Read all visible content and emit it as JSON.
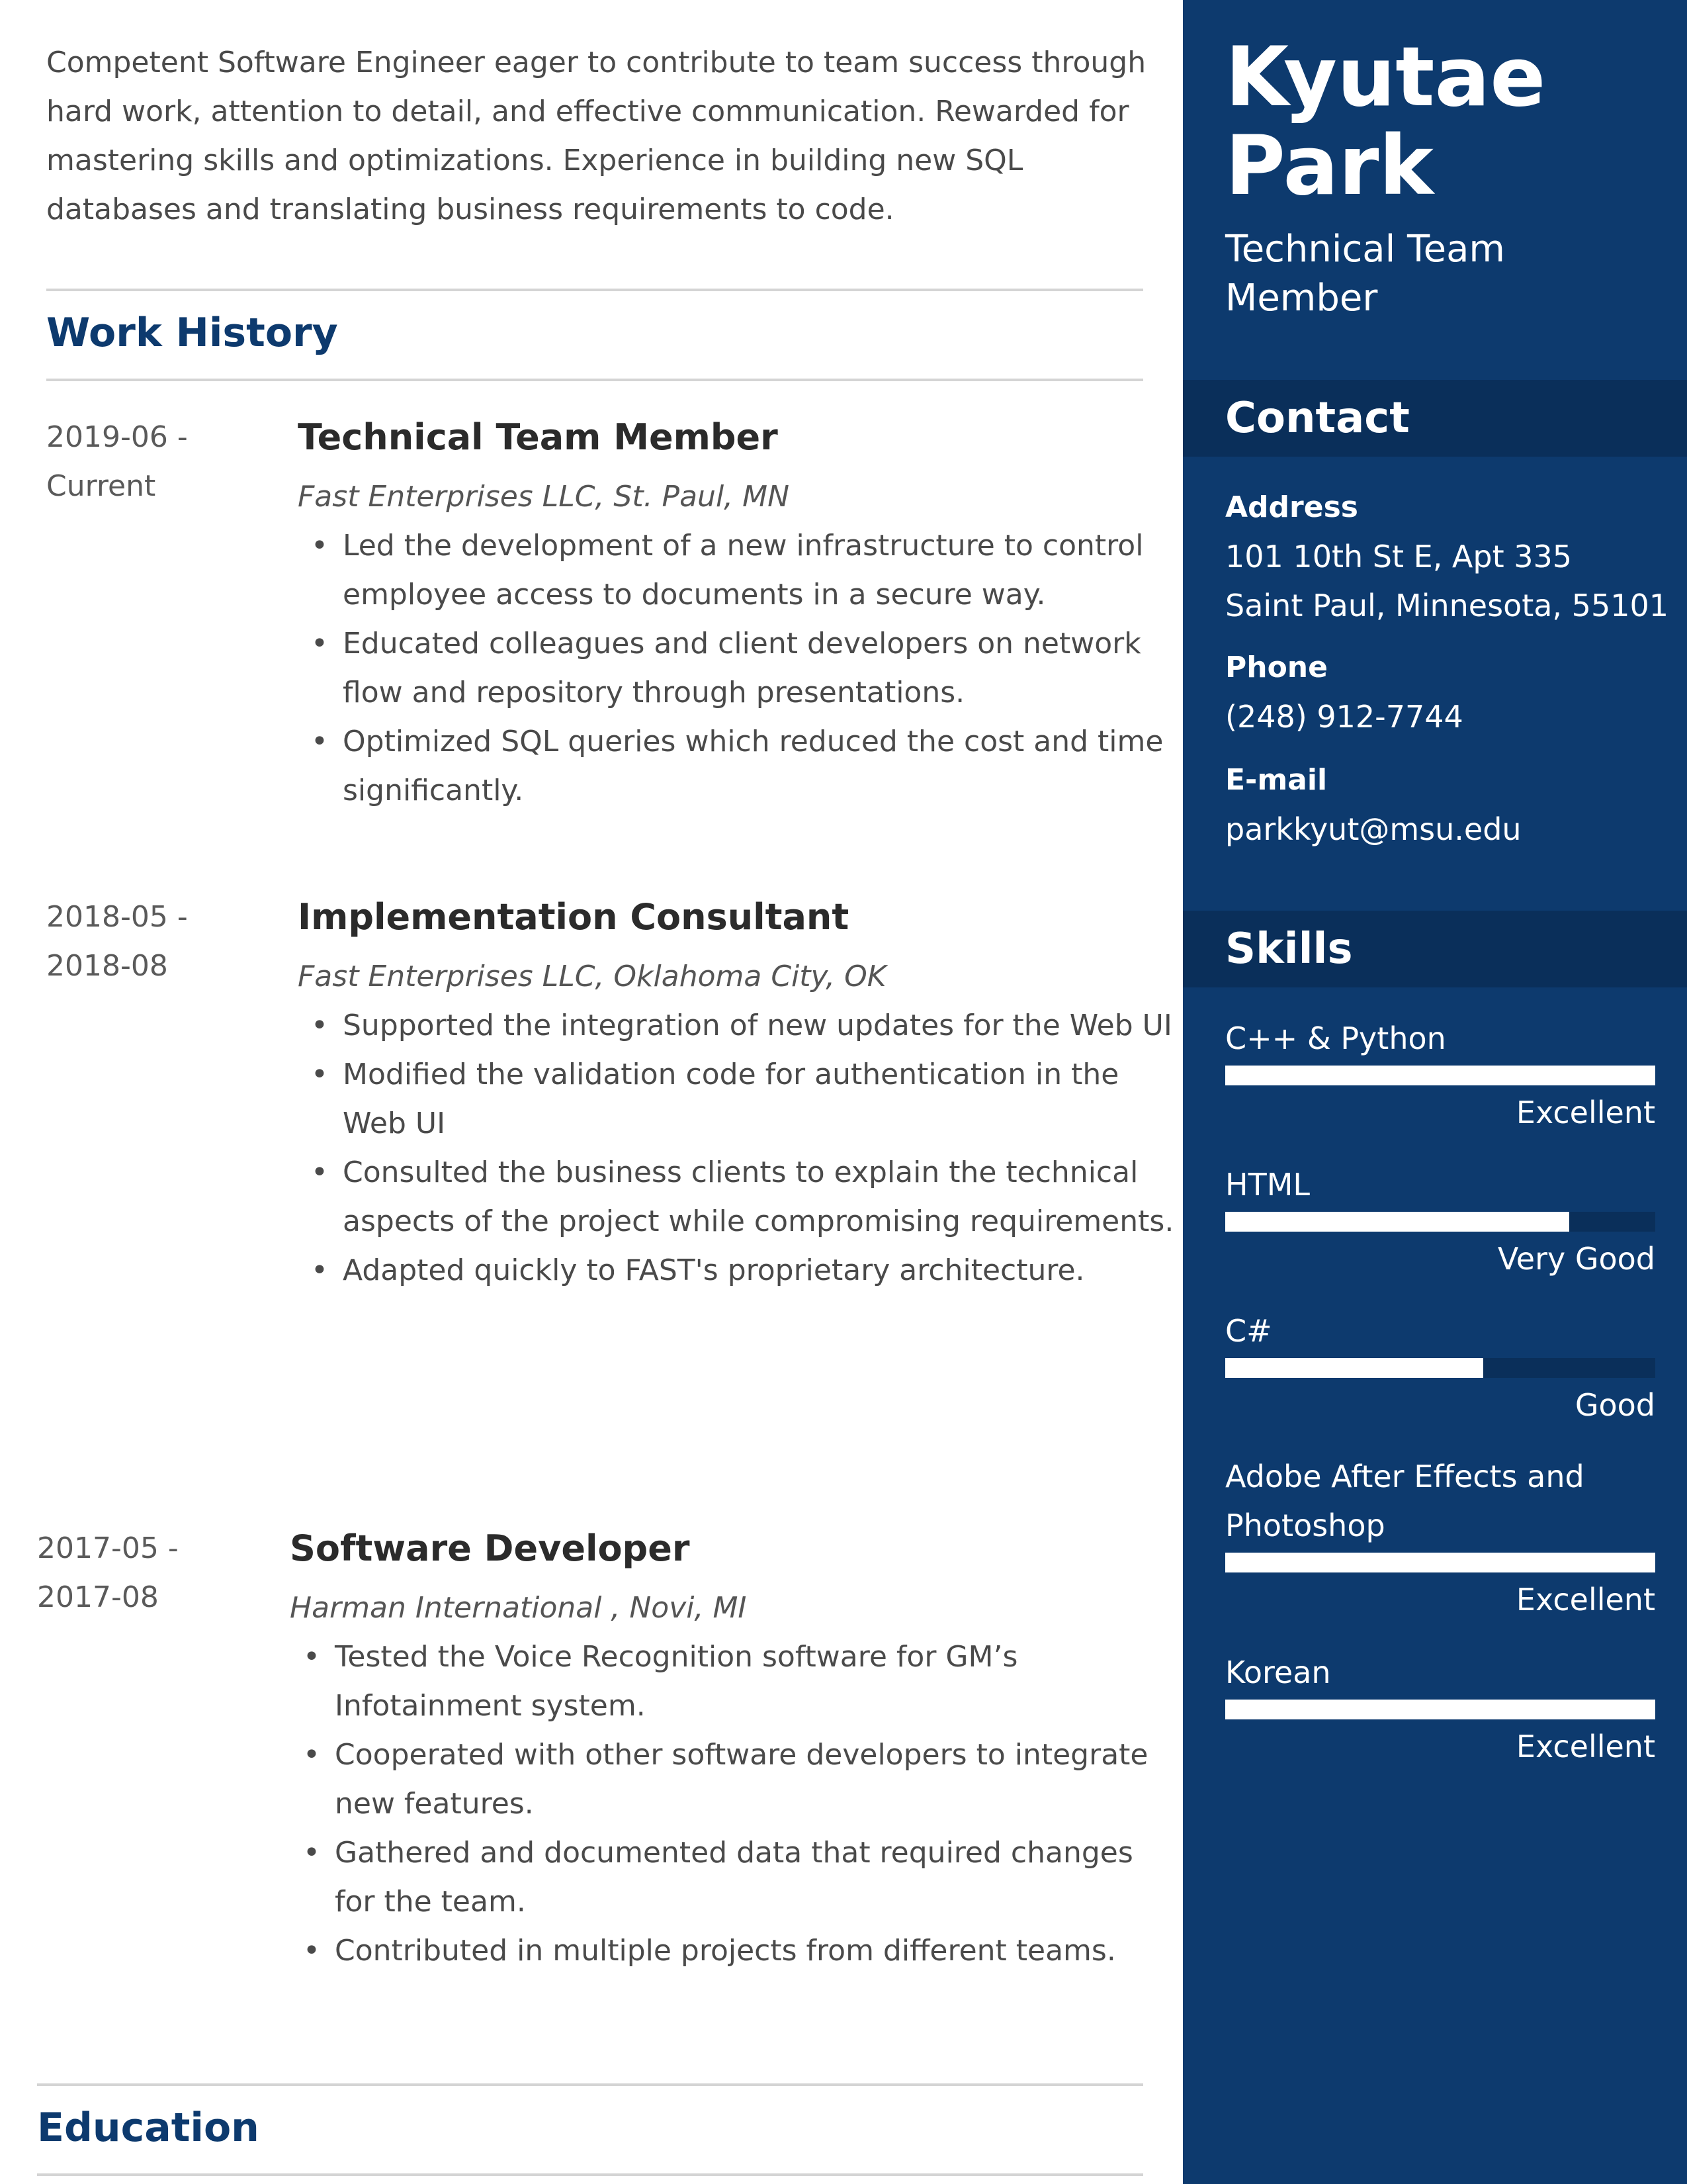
{
  "summary": "Competent Software Engineer eager to contribute to team success through hard work, attention to detail, and effective communication. Rewarded for mastering skills and optimizations. Experience in building new SQL databases and translating business requirements to code.",
  "sections": {
    "work_history": "Work History",
    "education": "Education"
  },
  "jobs": [
    {
      "date_start": "2019-06 -",
      "date_end": "Current",
      "title": "Technical Team Member",
      "company": "Fast Enterprises LLC, St. Paul, MN",
      "bullets": [
        "Led the development of a new infrastructure to control employee access to documents in a secure way.",
        "Educated colleagues and client developers on network flow and repository through presentations.",
        "Optimized SQL queries which reduced the cost and time significantly."
      ]
    },
    {
      "date_start": "2018-05 -",
      "date_end": "2018-08",
      "title": "Implementation Consultant",
      "company": "Fast Enterprises LLC, Oklahoma City, OK",
      "bullets": [
        "Supported the integration of new updates for the Web UI",
        "Modified the validation code for authentication in the Web UI",
        "Consulted the business clients to explain the technical aspects of the project while compromising requirements.",
        "Adapted quickly to FAST's proprietary architecture."
      ]
    },
    {
      "date_start": "2017-05 -",
      "date_end": "2017-08",
      "title": "Software Developer",
      "company": "Harman International , Novi, MI",
      "bullets": [
        "Tested the Voice Recognition software for GM’s Infotainment system.",
        "Cooperated with other software developers to integrate new features.",
        "Gathered and documented data that required changes for the team.",
        "Contributed in multiple projects from different teams."
      ]
    }
  ],
  "sidebar": {
    "name": "Kyutae Park",
    "role": "Technical Team Member",
    "contact_title": "Contact",
    "address_label": "Address",
    "address_line1": "101 10th St E, Apt 335",
    "address_line2": "Saint Paul, Minnesota, 55101",
    "phone_label": "Phone",
    "phone": "(248) 912-7744",
    "email_label": "E-mail",
    "email": "parkkyut@msu.edu",
    "skills_title": "Skills",
    "skills": [
      {
        "name": "C++ & Python",
        "level": "Excellent",
        "fill": 1.0
      },
      {
        "name": "HTML",
        "level": "Very Good",
        "fill": 0.8
      },
      {
        "name": "C#",
        "level": "Good",
        "fill": 0.6
      },
      {
        "name": "Adobe After Effects and Photoshop",
        "level": "Excellent",
        "fill": 1.0
      },
      {
        "name": "Korean",
        "level": "Excellent",
        "fill": 1.0
      }
    ]
  },
  "colors": {
    "accent": "#0d3a6e",
    "sidebar_band": "#0a2f5a"
  }
}
